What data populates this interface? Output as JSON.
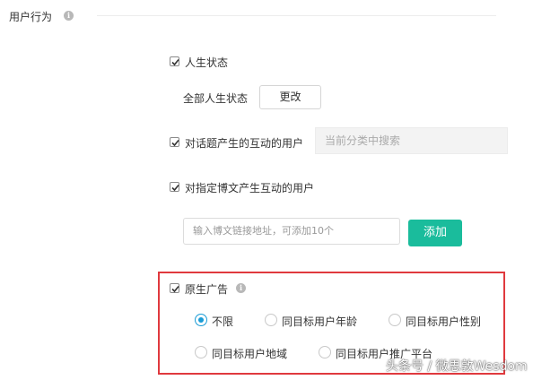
{
  "section": {
    "title": "用户行为",
    "info_icon": "info-icon"
  },
  "life_status": {
    "label": "人生状态",
    "checked": true,
    "all_label": "全部人生状态",
    "change_button": "更改"
  },
  "topic_interact": {
    "label": "对话题产生的互动的用户",
    "checked": true,
    "search_placeholder": "当前分类中搜索"
  },
  "post_interact": {
    "label": "对指定博文产生互动的用户",
    "checked": true,
    "url_placeholder": "输入博文链接地址，可添加10个",
    "add_button": "添加"
  },
  "native_ad": {
    "label": "原生广告",
    "checked": true,
    "options": [
      {
        "label": "不限",
        "selected": true
      },
      {
        "label": "同目标用户年龄",
        "selected": false
      },
      {
        "label": "同目标用户性别",
        "selected": false
      },
      {
        "label": "同目标用户地域",
        "selected": false
      },
      {
        "label": "同目标用户推广平台",
        "selected": false
      }
    ]
  },
  "watermark": "头条号 / 微思敦Wesdom",
  "colors": {
    "accent": "#1abc9c",
    "radio": "#1a9cd6",
    "highlight": "#e0393e"
  }
}
